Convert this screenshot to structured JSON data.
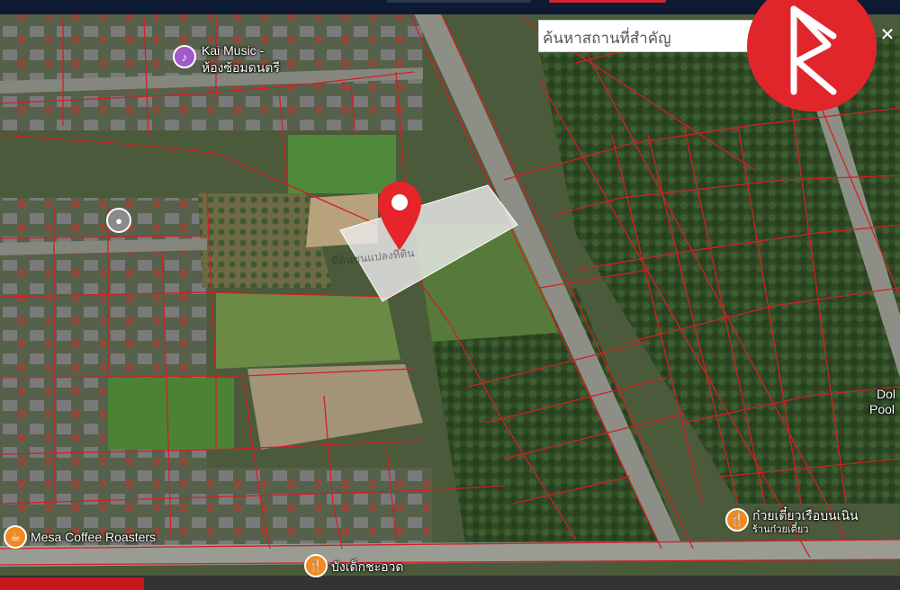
{
  "search": {
    "placeholder": "ค้นหาสถานที่สำคัญ",
    "close_label": "✕"
  },
  "parcel_overlay_text": "ที่ดินชนแปลงที่ดิน",
  "pois": [
    {
      "name": "Kai Music -",
      "name2": "ห้องซ้อมดนตรี",
      "icon": "music-icon",
      "color": "#a259c9"
    },
    {
      "name": "Mesa Coffee Roasters",
      "icon": "cafe-icon",
      "color": "#f08a24"
    },
    {
      "name": "บังเด็กชะอวด",
      "icon": "restaurant-icon",
      "color": "#f08a24"
    },
    {
      "name": "ก๋วยเตี๋ยวเรือบนเนิน",
      "name2": "ร้านก๋วยเตี๋ยว",
      "icon": "restaurant-icon",
      "color": "#f08a24"
    },
    {
      "name": "Dol",
      "name2": "Pool",
      "icon": "",
      "color": ""
    },
    {
      "name": "",
      "icon": "location-icon",
      "color": "#8a8a8a"
    }
  ],
  "colors": {
    "parcel_line": "#d21f26",
    "pin": "#e5252a",
    "logo": "#e0262b"
  }
}
